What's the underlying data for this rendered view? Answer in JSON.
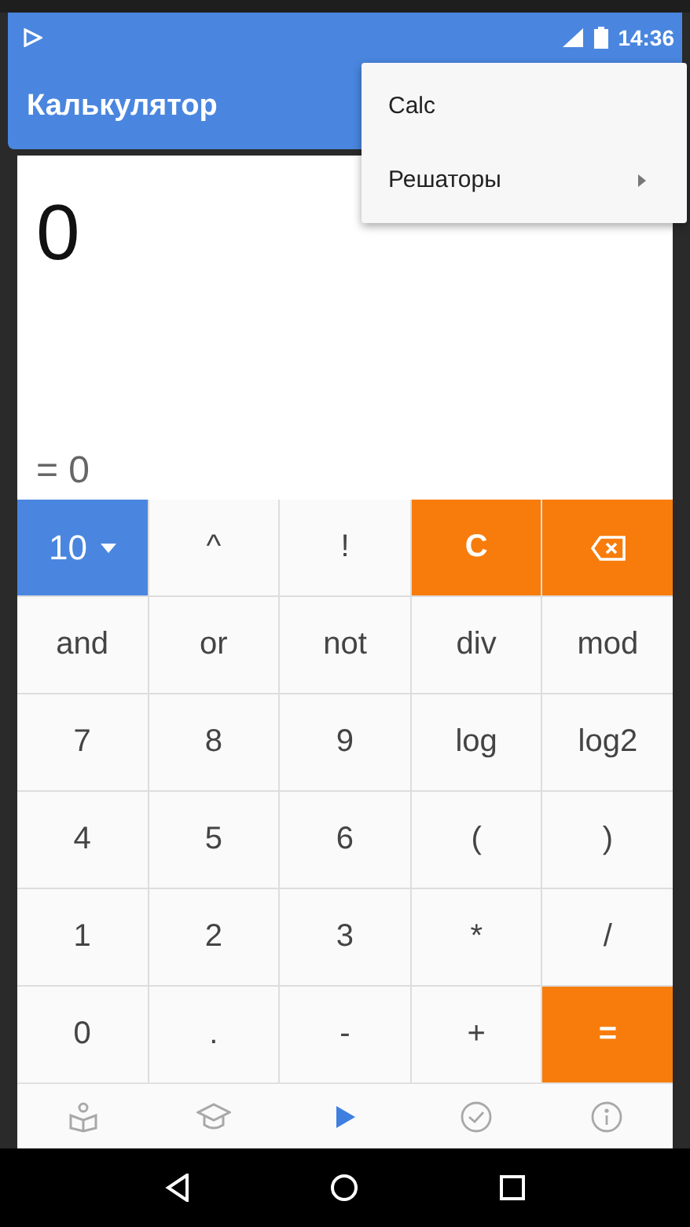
{
  "status_bar": {
    "time": "14:36"
  },
  "app_bar": {
    "title": "Калькулятор"
  },
  "menu": {
    "items": [
      {
        "label": "Calc",
        "has_submenu": false
      },
      {
        "label": "Решаторы",
        "has_submenu": true
      }
    ]
  },
  "display": {
    "expression": "0",
    "result": "= 0"
  },
  "keys": [
    {
      "kind": "base",
      "label": "10"
    },
    {
      "kind": "key",
      "label": "^"
    },
    {
      "kind": "key",
      "label": "!"
    },
    {
      "kind": "accent",
      "label": "C"
    },
    {
      "kind": "backspace"
    },
    {
      "kind": "key",
      "label": "and"
    },
    {
      "kind": "key",
      "label": "or"
    },
    {
      "kind": "key",
      "label": "not"
    },
    {
      "kind": "key",
      "label": "div"
    },
    {
      "kind": "key",
      "label": "mod"
    },
    {
      "kind": "key",
      "label": "7"
    },
    {
      "kind": "key",
      "label": "8"
    },
    {
      "kind": "key",
      "label": "9"
    },
    {
      "kind": "key",
      "label": "log"
    },
    {
      "kind": "key",
      "label": "log2"
    },
    {
      "kind": "key",
      "label": "4"
    },
    {
      "kind": "key",
      "label": "5"
    },
    {
      "kind": "key",
      "label": "6"
    },
    {
      "kind": "key",
      "label": "("
    },
    {
      "kind": "key",
      "label": ")"
    },
    {
      "kind": "key",
      "label": "1"
    },
    {
      "kind": "key",
      "label": "2"
    },
    {
      "kind": "key",
      "label": "3"
    },
    {
      "kind": "key",
      "label": "*"
    },
    {
      "kind": "key",
      "label": "/"
    },
    {
      "kind": "key",
      "label": "0"
    },
    {
      "kind": "key",
      "label": "."
    },
    {
      "kind": "key",
      "label": "-"
    },
    {
      "kind": "key",
      "label": "+"
    },
    {
      "kind": "accent",
      "label": "="
    }
  ],
  "bottom_nav": [
    {
      "kind": "book",
      "selected": false
    },
    {
      "kind": "cap",
      "selected": false
    },
    {
      "kind": "play",
      "selected": true
    },
    {
      "kind": "check",
      "selected": false
    },
    {
      "kind": "info",
      "selected": false
    }
  ]
}
